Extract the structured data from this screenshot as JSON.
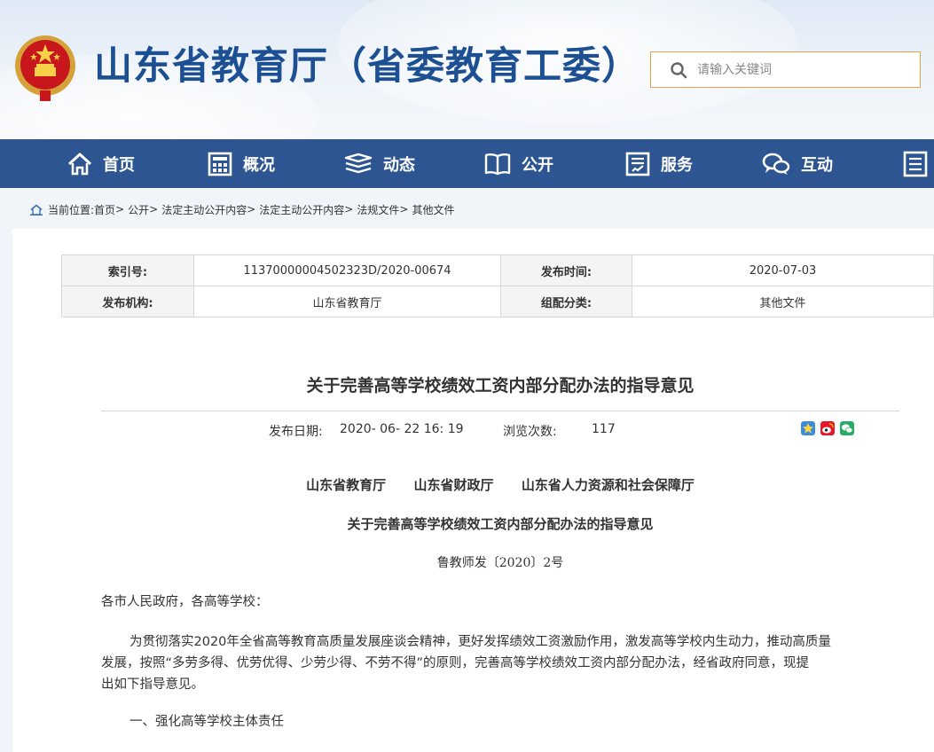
{
  "header": {
    "site_title": "山东省教育厅（省委教育工委）",
    "search_placeholder": "请输入关键词"
  },
  "nav": {
    "items": [
      {
        "label": "首页",
        "icon": "home-icon"
      },
      {
        "label": "概况",
        "icon": "building-icon"
      },
      {
        "label": "动态",
        "icon": "news-stack-icon"
      },
      {
        "label": "公开",
        "icon": "open-book-icon"
      },
      {
        "label": "服务",
        "icon": "service-clipboard-icon"
      },
      {
        "label": "互动",
        "icon": "chat-bubbles-icon"
      },
      {
        "label": "",
        "icon": "document-list-icon"
      }
    ]
  },
  "breadcrumb": {
    "prefix": "当前位置:",
    "items": [
      "首页",
      "公开",
      "法定主动公开内容",
      "法定主动公开内容",
      "法规文件",
      "其他文件"
    ],
    "separator": ">"
  },
  "meta": {
    "index_label": "索引号:",
    "index_value": "11370000004502323D/2020-00674",
    "publish_time_label": "发布时间:",
    "publish_time_value": "2020-07-03",
    "org_label": "发布机构:",
    "org_value": "山东省教育厅",
    "category_label": "组配分类:",
    "category_value": "其他文件"
  },
  "article": {
    "title": "关于完善高等学校绩效工资内部分配办法的指导意见",
    "date_label": "发布日期:",
    "date_value": "2020- 06- 22 16: 19",
    "views_label": "浏览次数:",
    "views_value": "117",
    "issuers": "山东省教育厅      山东省财政厅      山东省人力资源和社会保障厅",
    "subtitle": "关于完善高等学校绩效工资内部分配办法的指导意见",
    "doc_number": "鲁教师发〔2020〕2号",
    "salutation": "各市人民政府，各高等学校：",
    "para1_line1": "为贯彻落实2020年全省高等教育高质量发展座谈会精神，更好发挥绩效工资激励作用，激发高等学校内生动力，推动高质量",
    "para1_line2": "发展，按照“多劳多得、优劳优得、少劳少得、不劳不得”的原则，完善高等学校绩效工资内部分配办法，经省政府同意，现提",
    "para1_line3": "出如下指导意见。",
    "section1": "一、强化高等学校主体责任"
  },
  "colors": {
    "nav_bg": "#2d5591",
    "title_blue": "#1d4f93",
    "search_border": "#e3a24a"
  }
}
